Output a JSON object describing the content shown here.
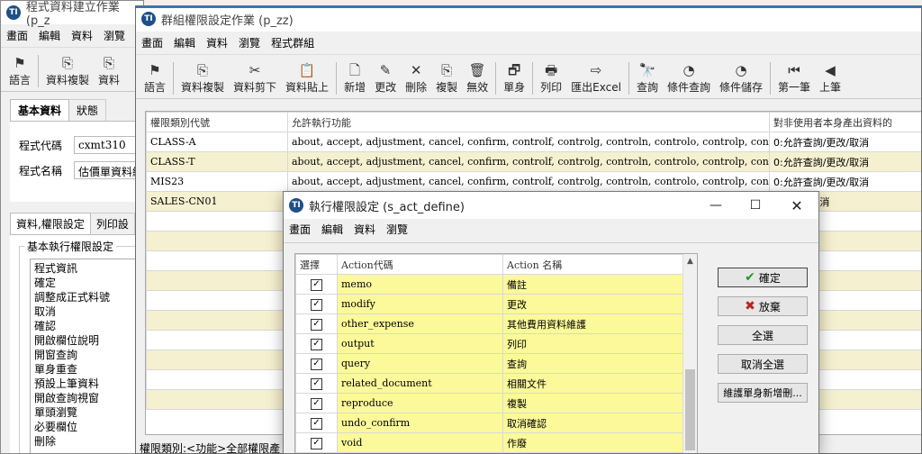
{
  "back": {
    "title": "程式資料建立作業(p_z",
    "menu": [
      "畫面",
      "編輯",
      "資料",
      "瀏覽"
    ],
    "tools": [
      "語言",
      "資料複製",
      "資料"
    ],
    "tabs": [
      "基本資料",
      "狀態"
    ],
    "fields": {
      "code_label": "程式代碼",
      "code_value": "cxmt310",
      "name_label": "程式名稱",
      "name_value": "估價單資料維"
    },
    "tabs2": [
      "資料,權限設定",
      "列印設"
    ],
    "group_title": "基本執行權限設定",
    "perms": [
      "程式資訊",
      "確定",
      "調整成正式料號",
      "取消",
      "確認",
      "開啟欄位說明",
      "開窗查詢",
      "單身重查",
      "預設上筆資料",
      "開啟查詢視窗",
      "單頭瀏覽",
      "必要欄位",
      "刪除"
    ]
  },
  "group": {
    "title": "群組權限設定作業 (p_zz)",
    "menu": [
      "畫面",
      "編輯",
      "資料",
      "瀏覽",
      "程式群組"
    ],
    "tools": [
      {
        "label": "語言",
        "icon": "⚑"
      },
      {
        "label": "資料複製",
        "icon": "⎘"
      },
      {
        "label": "資料剪下",
        "icon": "✂"
      },
      {
        "label": "資料貼上",
        "icon": "📋"
      },
      {
        "label": "新增",
        "icon": "🗋"
      },
      {
        "label": "更改",
        "icon": "✎"
      },
      {
        "label": "刪除",
        "icon": "✕"
      },
      {
        "label": "複製",
        "icon": "⎘"
      },
      {
        "label": "無效",
        "icon": "🗑"
      },
      {
        "label": "單身",
        "icon": "🗗"
      },
      {
        "label": "列印",
        "icon": "🖶"
      },
      {
        "label": "匯出Excel",
        "icon": "⇨"
      },
      {
        "label": "查詢",
        "icon": "🔭"
      },
      {
        "label": "條件查詢",
        "icon": "◔"
      },
      {
        "label": "條件儲存",
        "icon": "◔"
      },
      {
        "label": "第一筆",
        "icon": "⏮"
      },
      {
        "label": "上筆",
        "icon": "◀"
      }
    ],
    "columns": [
      "權限類別代號",
      "允許執行功能",
      "對非使用者本身產出資料的"
    ],
    "rows": [
      {
        "code": "CLASS-A",
        "funcs": "about, accept, adjustment, cancel, confirm, controlf, controlg, controln, controlo, controlp, controls, control",
        "scope": "0:允許查詢/更改/取消"
      },
      {
        "code": "CLASS-T",
        "funcs": "about, accept, adjustment, cancel, confirm, controlf, controlg, controln, controlo, controlp, controls, control",
        "scope": "0:允許查詢/更改/取消"
      },
      {
        "code": "MIS23",
        "funcs": "about, accept, adjustment, cancel, confirm, controlf, controlg, controln, controlo, controlp, controls, control",
        "scope": "0:允許查詢/更改/取消"
      },
      {
        "code": "SALES-CN01",
        "funcs": "",
        "scope": "詢/更改/取消"
      }
    ],
    "status": "權限類別:<功能>全部權限產"
  },
  "dialog": {
    "title": "執行權限設定 (s_act_define)",
    "menu": [
      "畫面",
      "編輯",
      "資料",
      "瀏覽"
    ],
    "columns": [
      "選擇",
      "Action代碼",
      "Action 名稱"
    ],
    "rows": [
      {
        "checked": true,
        "code": "memo",
        "name": "備註"
      },
      {
        "checked": true,
        "code": "modify",
        "name": "更改"
      },
      {
        "checked": true,
        "code": "other_expense",
        "name": "其他費用資料維護"
      },
      {
        "checked": true,
        "code": "output",
        "name": "列印"
      },
      {
        "checked": true,
        "code": "query",
        "name": "查詢"
      },
      {
        "checked": true,
        "code": "related_document",
        "name": "相關文件"
      },
      {
        "checked": true,
        "code": "reproduce",
        "name": "複製"
      },
      {
        "checked": true,
        "code": "undo_confirm",
        "name": "取消確認"
      },
      {
        "checked": true,
        "code": "void",
        "name": "作廢"
      }
    ],
    "buttons": {
      "ok": "確定",
      "cancel": "放棄",
      "select_all": "全選",
      "deselect_all": "取消全選",
      "maintain": "維護單身新增刪..."
    }
  }
}
